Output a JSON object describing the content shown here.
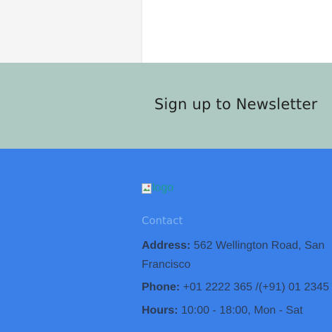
{
  "newsletter": {
    "title": "Sign up to Newsletter"
  },
  "footer": {
    "logo_alt": "logo",
    "contact_heading": "Contact",
    "address_label": "Address:",
    "address_value": " 562 Wellington Road, San",
    "address_value_line2": "Francisco",
    "phone_label": "Phone:",
    "phone_value": " +01 2222 365 /(+91) 01 2345",
    "hours_label": "Hours:",
    "hours_value": " 10:00 - 18:00, Mon - Sat"
  },
  "colors": {
    "newsletter_bg": "#adc9c1",
    "footer_bg": "#3b80e8",
    "contact_heading": "#7fb4f0"
  },
  "icons": {
    "logo": "broken-image-icon"
  }
}
